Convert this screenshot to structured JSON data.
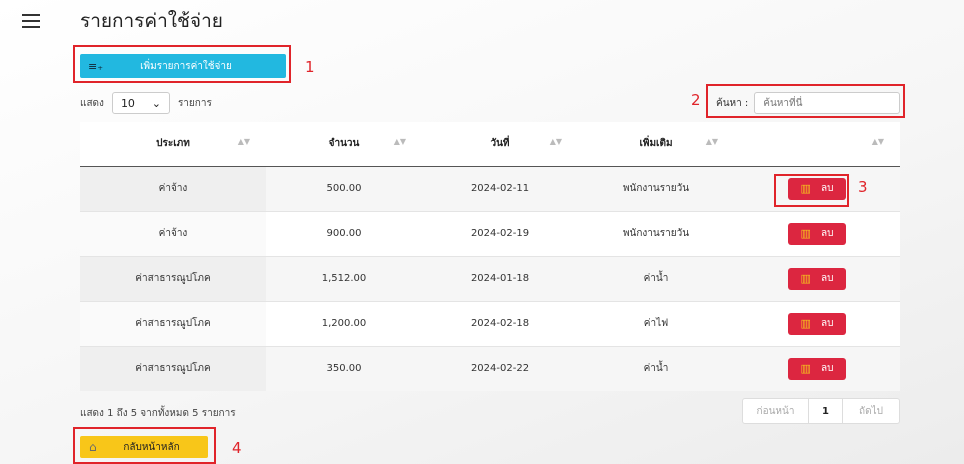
{
  "page": {
    "title": "รายการค่าใช้จ่าย"
  },
  "toolbar": {
    "add_label": "เพิ่มรายการค่าใช้จ่าย",
    "add_icon": "playlist-add-icon"
  },
  "length": {
    "prefix": "แสดง",
    "value": "10",
    "suffix": "รายการ"
  },
  "search": {
    "label": "ค้นหา :",
    "placeholder": "ค้นหาที่นี่"
  },
  "table": {
    "headers": [
      "ประเภท",
      "จำนวน",
      "วันที่",
      "เพิ่มเติม",
      ""
    ],
    "rows": [
      {
        "type": "ค่าจ้าง",
        "amount": "500.00",
        "date": "2024-02-11",
        "note": "พนักงานรายวัน",
        "action": "ลบ"
      },
      {
        "type": "ค่าจ้าง",
        "amount": "900.00",
        "date": "2024-02-19",
        "note": "พนักงานรายวัน",
        "action": "ลบ"
      },
      {
        "type": "ค่าสาธารณูปโภค",
        "amount": "1,512.00",
        "date": "2024-01-18",
        "note": "ค่าน้ำ",
        "action": "ลบ"
      },
      {
        "type": "ค่าสาธารณูปโภค",
        "amount": "1,200.00",
        "date": "2024-02-18",
        "note": "ค่าไฟ",
        "action": "ลบ"
      },
      {
        "type": "ค่าสาธารณูปโภค",
        "amount": "350.00",
        "date": "2024-02-22",
        "note": "ค่าน้ำ",
        "action": "ลบ"
      }
    ]
  },
  "footer": {
    "info": "แสดง 1 ถึง 5 จากทั้งหมด 5 รายการ",
    "prev": "ก่อนหน้า",
    "page": "1",
    "next": "ถัดไป"
  },
  "home": {
    "label": "กลับหน้าหลัก",
    "icon": "home-icon"
  },
  "annotations": [
    "1",
    "2",
    "3",
    "4"
  ],
  "colors": {
    "add": "#22b8e0",
    "delete": "#dc2640",
    "home": "#f8c619",
    "annotation": "#e0242a"
  }
}
